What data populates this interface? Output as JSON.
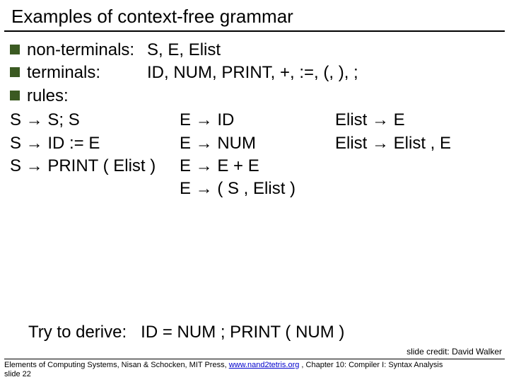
{
  "title": "Examples of context-free grammar",
  "items": {
    "nonterminals_label": "non-terminals:",
    "nonterminals_val": "S, E, Elist",
    "terminals_label": "terminals:",
    "terminals_val": "ID, NUM, PRINT, +, :=, (, ), ;",
    "rules_label": "rules:"
  },
  "rules": {
    "s": [
      "S → S; S",
      "S → ID := E",
      "S → PRINT ( Elist )"
    ],
    "e": [
      "E → ID",
      "E → NUM",
      "E → E + E",
      "E → ( S , Elist )"
    ],
    "el": [
      "Elist → E",
      "Elist → Elist , E"
    ]
  },
  "try_label": "Try to derive:",
  "try_expr": "ID = NUM ; PRINT ( NUM )",
  "credit": "slide credit: David Walker",
  "footer": {
    "text_before": "Elements of Computing Systems, Nisan & Schocken, MIT Press, ",
    "link": "www.nand2tetris.org",
    "text_after": " , Chapter 10: Compiler I: Syntax Analysis",
    "slide_no": "slide 22"
  }
}
